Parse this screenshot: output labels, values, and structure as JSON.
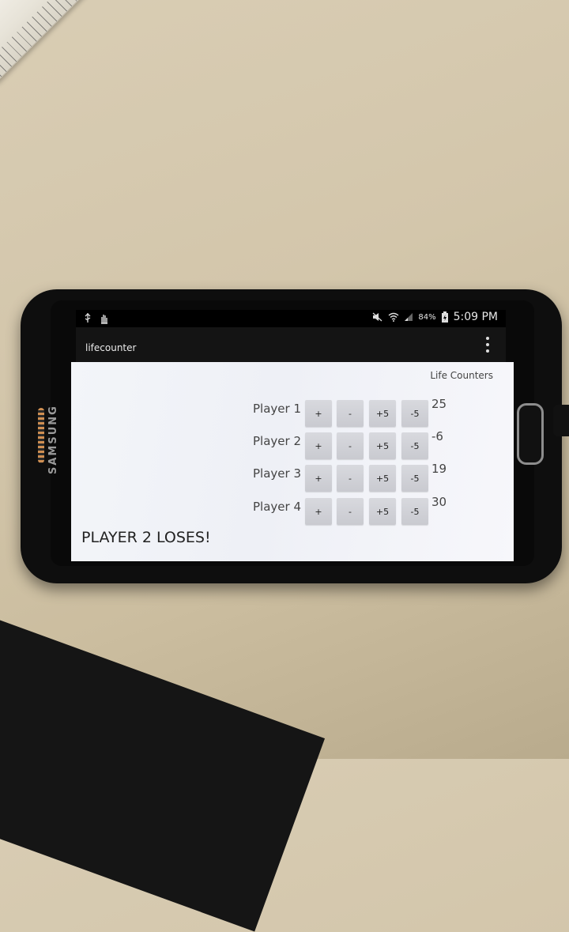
{
  "status_bar": {
    "battery_percent": "84%",
    "time": "5:09 PM",
    "icons": [
      "usb-icon",
      "hand-icon",
      "mute-icon",
      "wifi-icon",
      "signal-icon",
      "battery-icon"
    ]
  },
  "action_bar": {
    "title": "lifecounter",
    "menu_icon": "overflow-menu-icon"
  },
  "section": {
    "title": "Life Counters"
  },
  "buttons": {
    "plus": "+",
    "minus": "-",
    "plus5": "+5",
    "minus5": "-5"
  },
  "players": [
    {
      "name": "Player 1",
      "life": "25"
    },
    {
      "name": "Player 2",
      "life": "-6"
    },
    {
      "name": "Player 3",
      "life": "19"
    },
    {
      "name": "Player 4",
      "life": "30"
    }
  ],
  "message": "PLAYER 2 LOSES!",
  "device": {
    "brand": "SAMSUNG"
  }
}
